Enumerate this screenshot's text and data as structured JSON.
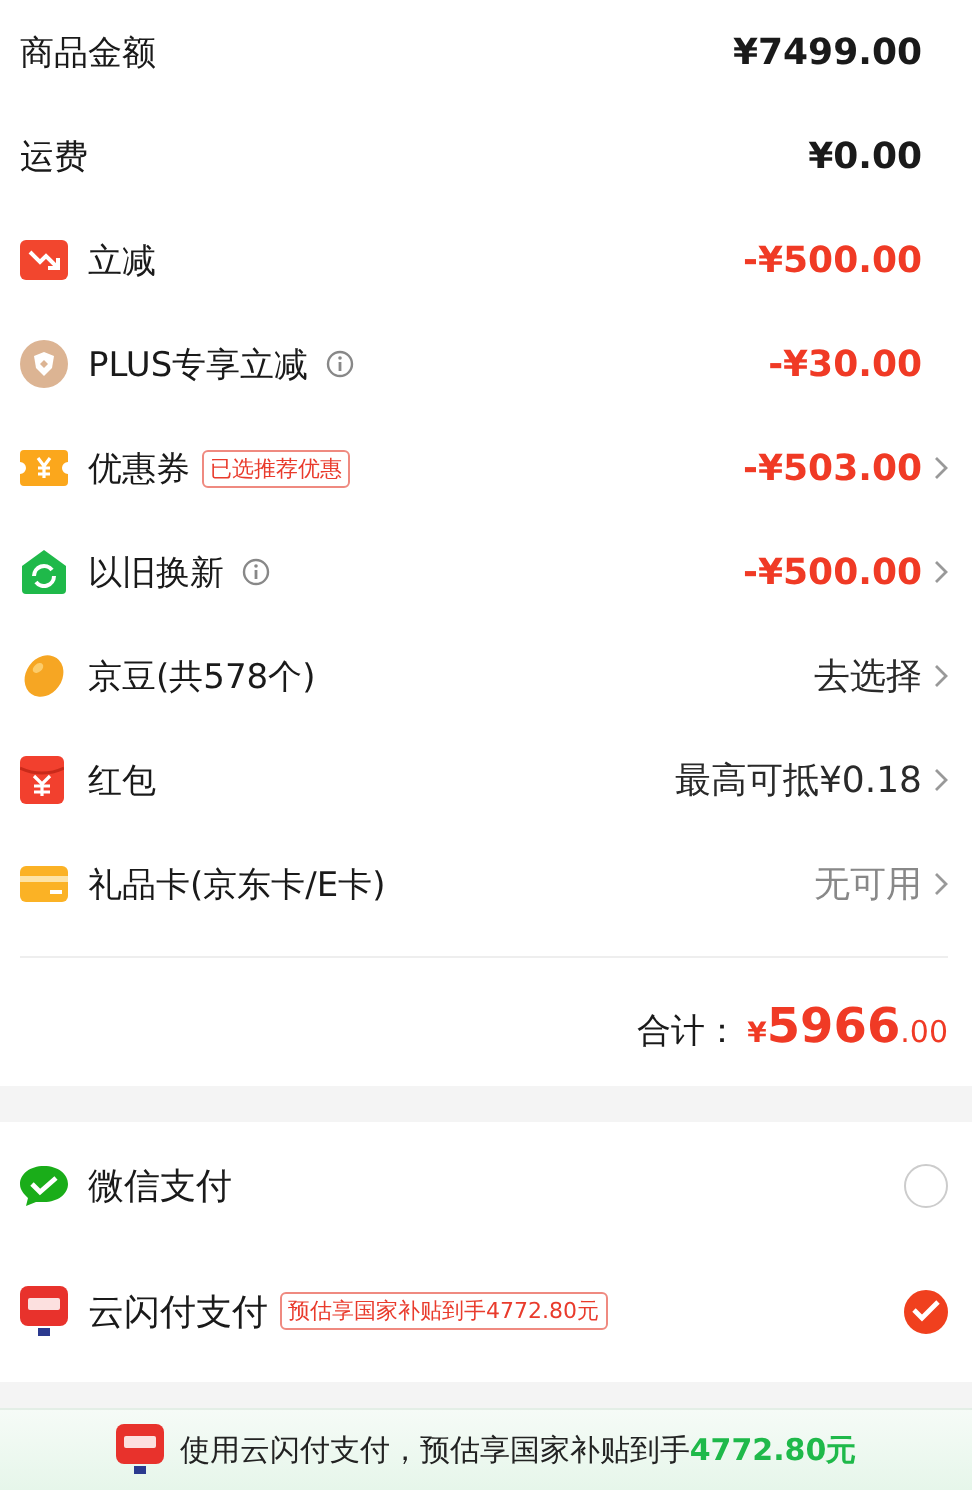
{
  "summary_rows": [
    {
      "kind": "plain",
      "label": "商品金额",
      "value": "¥7499.00",
      "discount": false,
      "emphasized": true,
      "muted": false,
      "chevron": false
    },
    {
      "kind": "plain",
      "label": "运费",
      "value": "¥0.00",
      "discount": false,
      "emphasized": true,
      "muted": false,
      "chevron": false
    },
    {
      "kind": "instant-discount",
      "label": "立减",
      "value": "-¥500.00",
      "discount": true,
      "emphasized": true,
      "muted": false,
      "chevron": false
    },
    {
      "kind": "plus",
      "label": "PLUS专享立减",
      "info": true,
      "value": "-¥30.00",
      "discount": true,
      "emphasized": true,
      "muted": false,
      "chevron": false
    },
    {
      "kind": "coupon",
      "label": "优惠券",
      "tag": "已选推荐优惠",
      "value": "-¥503.00",
      "discount": true,
      "emphasized": true,
      "muted": false,
      "chevron": true
    },
    {
      "kind": "trade-in",
      "label": "以旧换新",
      "info": true,
      "value": "-¥500.00",
      "discount": true,
      "emphasized": true,
      "muted": false,
      "chevron": true
    },
    {
      "kind": "beans",
      "label": "京豆(共578个)",
      "value": "去选择",
      "discount": false,
      "emphasized": false,
      "muted": false,
      "chevron": true
    },
    {
      "kind": "red-packet",
      "label": "红包",
      "value": "最高可抵¥0.18",
      "discount": false,
      "emphasized": false,
      "muted": false,
      "chevron": true
    },
    {
      "kind": "gift-card",
      "label": "礼品卡(京东卡/E卡)",
      "value": "无可用",
      "discount": false,
      "emphasized": false,
      "muted": true,
      "chevron": true
    }
  ],
  "total": {
    "label": "合计：",
    "currency": "¥",
    "integer": "5966",
    "decimal": ".00"
  },
  "payment_methods": [
    {
      "kind": "wechat",
      "label": "微信支付",
      "selected": false
    },
    {
      "kind": "unionpay",
      "label": "云闪付支付",
      "tag": "预估享国家补贴到手4772.80元",
      "selected": true
    }
  ],
  "banner": {
    "text": "使用云闪付支付，预估享国家补贴到手",
    "amount": "4772.80元"
  }
}
